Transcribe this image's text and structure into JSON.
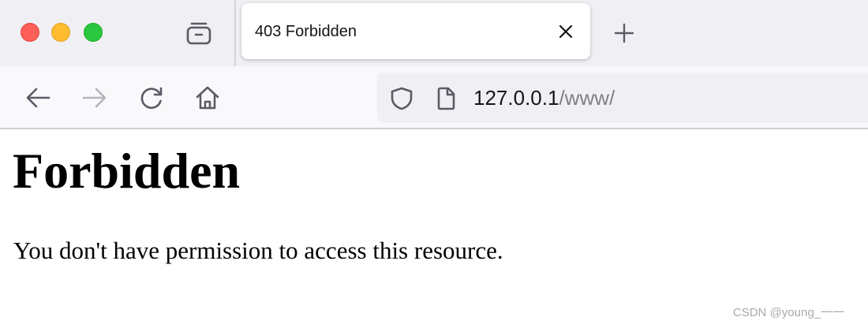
{
  "browser": {
    "window_controls": [
      "close",
      "minimize",
      "zoom"
    ],
    "tab_list_icon": "tab-list-icon",
    "tab": {
      "title": "403 Forbidden",
      "close_icon": "close-icon"
    },
    "new_tab_icon": "plus-icon",
    "nav": {
      "back_icon": "arrow-left-icon",
      "forward_icon": "arrow-right-icon",
      "reload_icon": "reload-icon",
      "home_icon": "home-icon"
    },
    "urlbar": {
      "security_icon": "shield-icon",
      "page_icon": "page-icon",
      "host": "127.0.0.1",
      "path": "/www/"
    }
  },
  "page": {
    "heading": "Forbidden",
    "message": "You don't have permission to access this resource."
  },
  "watermark": "CSDN @young_一一",
  "colors": {
    "tabbar_bg": "#f0f0f4",
    "navbar_bg": "#f9f9fb",
    "traffic_red": "#fe5f57",
    "traffic_yellow": "#febc2e",
    "traffic_green": "#28c840"
  }
}
